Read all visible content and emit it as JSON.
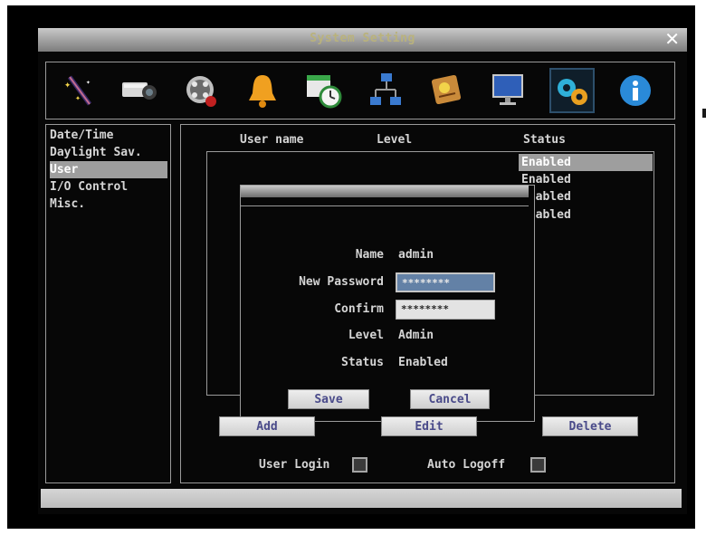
{
  "window": {
    "title": "System Setting"
  },
  "toolbar": {
    "icons": [
      "wizard-icon",
      "camera-icon",
      "record-icon",
      "alarm-icon",
      "schedule-icon",
      "network-icon",
      "event-icon",
      "display-icon",
      "system-icon",
      "info-icon"
    ]
  },
  "sidebar": {
    "items": [
      {
        "label": "Date/Time"
      },
      {
        "label": "Daylight Sav."
      },
      {
        "label": "User"
      },
      {
        "label": "I/O Control"
      },
      {
        "label": "Misc."
      }
    ]
  },
  "table": {
    "headers": {
      "user_name": "User name",
      "level": "Level",
      "status": "Status"
    },
    "status_values": [
      "Enabled",
      "Enabled",
      "Enabled",
      "Enabled"
    ]
  },
  "dialog": {
    "name_label": "Name",
    "name_value": "admin",
    "new_password_label": "New Password",
    "new_password_value": "********",
    "confirm_label": "Confirm",
    "confirm_value": "********",
    "level_label": "Level",
    "level_value": "Admin",
    "status_label": "Status",
    "status_value": "Enabled",
    "save_label": "Save",
    "cancel_label": "Cancel"
  },
  "actions": {
    "add_label": "Add",
    "edit_label": "Edit",
    "delete_label": "Delete"
  },
  "options": {
    "user_login_label": "User Login",
    "auto_logoff_label": "Auto Logoff"
  },
  "colors": {
    "selection": "#9e9e9e",
    "focus_field": "#6381a6",
    "button_text": "#4a4b8a",
    "title_text": "#b9b27c"
  }
}
